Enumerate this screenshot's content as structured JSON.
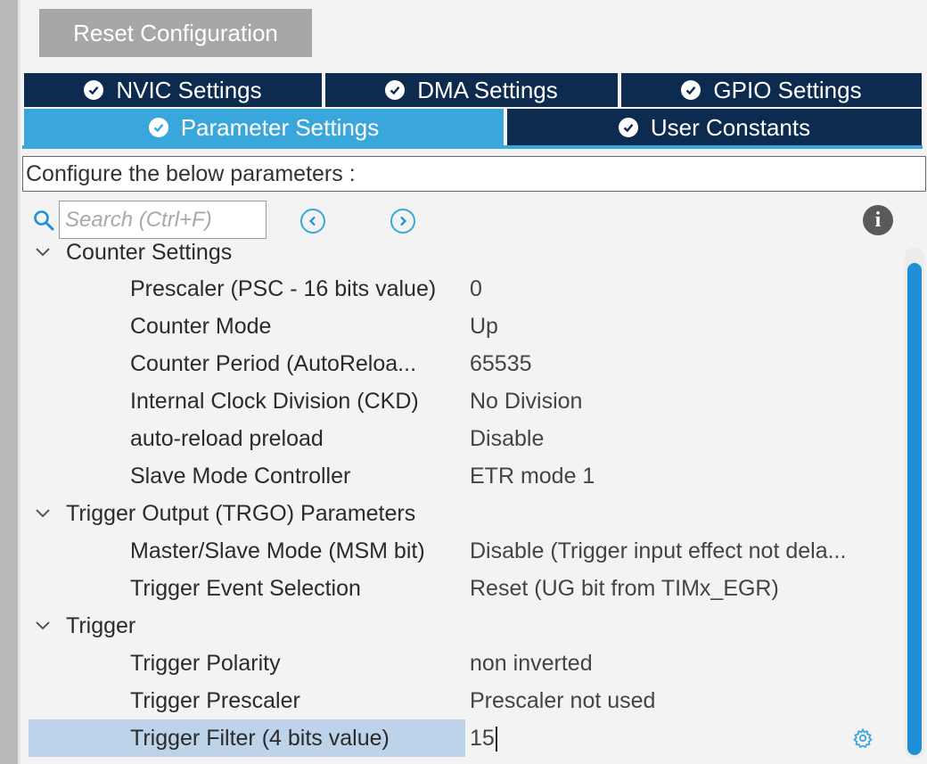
{
  "toolbar": {
    "reset_label": "Reset Configuration"
  },
  "tabs": [
    {
      "label": "NVIC Settings",
      "active": false
    },
    {
      "label": "DMA Settings",
      "active": false
    },
    {
      "label": "GPIO Settings",
      "active": false
    },
    {
      "label": "Parameter Settings",
      "active": true
    },
    {
      "label": "User Constants",
      "active": false
    }
  ],
  "description": "Configure the below parameters :",
  "search": {
    "placeholder": "Search (Ctrl+F)",
    "value": ""
  },
  "icons": {
    "search": "search-icon",
    "prev": "chevron-left-circle-icon",
    "next": "chevron-right-circle-icon",
    "info": "info-icon",
    "gear": "gear-icon",
    "check": "check-circle-icon"
  },
  "colors": {
    "tab_dark": "#0d2a4f",
    "tab_active": "#3aa7dc",
    "selection": "#bcd3ea",
    "scrollbar": "#1f8fd6"
  },
  "tree": {
    "groups": [
      {
        "label": "Counter Settings",
        "items": [
          {
            "label": "Prescaler (PSC - 16 bits value)",
            "value": "0"
          },
          {
            "label": "Counter Mode",
            "value": "Up"
          },
          {
            "label": "Counter Period (AutoReloa...",
            "value": "65535"
          },
          {
            "label": "Internal Clock Division (CKD)",
            "value": "No Division"
          },
          {
            "label": "auto-reload preload",
            "value": "Disable"
          },
          {
            "label": "Slave Mode Controller",
            "value": "ETR mode 1"
          }
        ]
      },
      {
        "label": "Trigger Output (TRGO) Parameters",
        "items": [
          {
            "label": "Master/Slave Mode (MSM bit)",
            "value": "Disable (Trigger input effect not dela..."
          },
          {
            "label": "Trigger Event Selection",
            "value": "Reset (UG bit from TIMx_EGR)"
          }
        ]
      },
      {
        "label": "Trigger",
        "items": [
          {
            "label": "Trigger Polarity",
            "value": "non inverted"
          },
          {
            "label": "Trigger Prescaler",
            "value": "Prescaler not used"
          },
          {
            "label": "Trigger Filter (4 bits value)",
            "value": "15",
            "selected": true,
            "editing": true
          }
        ]
      }
    ]
  }
}
